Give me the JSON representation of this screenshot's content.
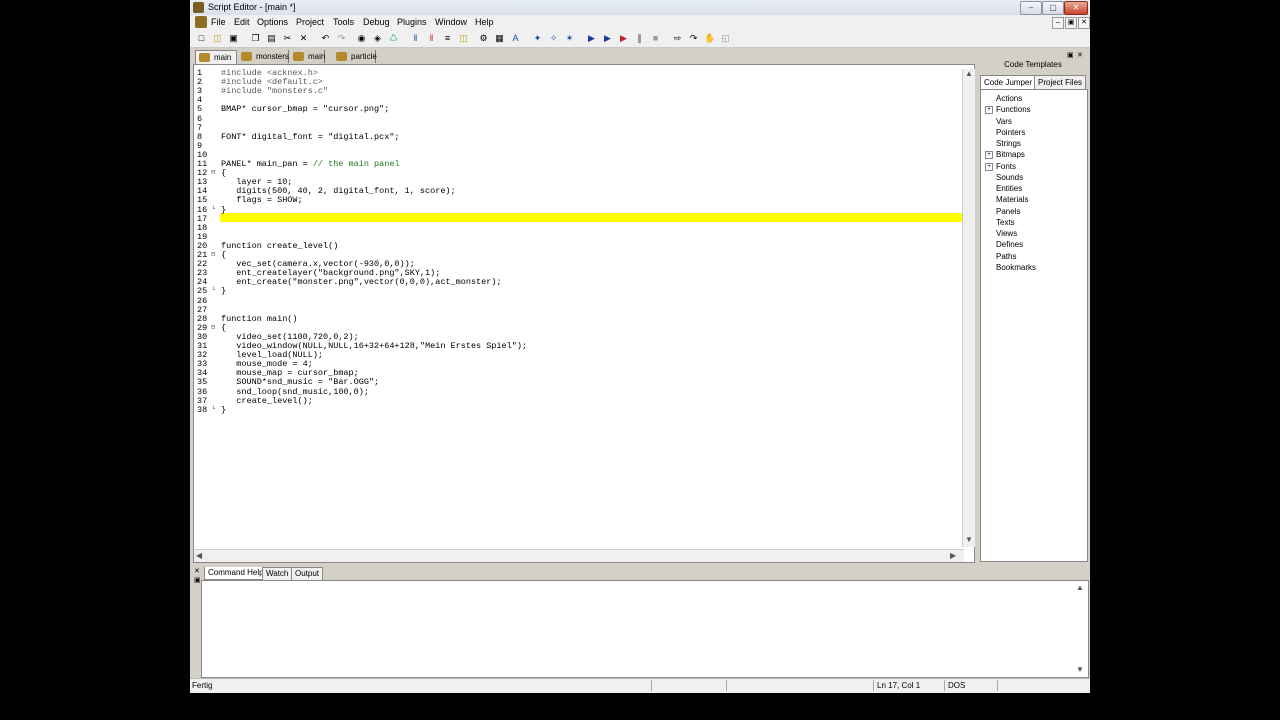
{
  "window": {
    "title": "Script Editor - [main *]"
  },
  "menu": [
    "File",
    "Edit",
    "Options",
    "Project",
    "Tools",
    "Debug",
    "Plugins",
    "Window",
    "Help"
  ],
  "tabs": [
    {
      "label": "main *",
      "active": true
    },
    {
      "label": "monsters",
      "active": false
    },
    {
      "label": "main",
      "active": false
    },
    {
      "label": "particle",
      "active": false
    }
  ],
  "code_lines": [
    "#include <acknex.h>",
    "#include <default.c>",
    "#include \"monsters.c\"",
    "",
    "BMAP* cursor_bmap = \"cursor.png\";",
    "",
    "",
    "FONT* digital_font = \"digital.pcx\";",
    "",
    "",
    "PANEL* main_pan = // the main panel",
    "{",
    "   layer = 10;",
    "   digits(500, 40, 2, digital_font, 1, score);",
    "   flags = SHOW;",
    "}",
    "",
    "",
    "",
    "function create_level()",
    "{",
    "   vec_set(camera.x,vector(-930,0,0));",
    "   ent_createlayer(\"background.png\",SKY,1);",
    "   ent_create(\"monster.png\",vector(0,0,0),act_monster);",
    "}",
    "",
    "",
    "function main()",
    "{",
    "   video_set(1100,720,0,2);",
    "   video_window(NULL,NULL,16+32+64+128,\"Mein Erstes Spiel\");",
    "   level_load(NULL);",
    "   mouse_mode = 4;",
    "   mouse_map = cursor_bmap;",
    "   SOUND*snd_music = \"Bar.OGG\";",
    "   snd_loop(snd_music,100,0);",
    "   create_level();",
    "}"
  ],
  "highlight_line": 17,
  "right_panel": {
    "header": "Code Templates",
    "tabs": [
      {
        "label": "Code Jumper",
        "active": true
      },
      {
        "label": "Project Files",
        "active": false
      }
    ],
    "tree": [
      {
        "label": "Actions",
        "expandable": false
      },
      {
        "label": "Functions",
        "expandable": true
      },
      {
        "label": "Vars",
        "expandable": false
      },
      {
        "label": "Pointers",
        "expandable": false
      },
      {
        "label": "Strings",
        "expandable": false
      },
      {
        "label": "Bitmaps",
        "expandable": true
      },
      {
        "label": "Fonts",
        "expandable": true
      },
      {
        "label": "Sounds",
        "expandable": false
      },
      {
        "label": "Entities",
        "expandable": false
      },
      {
        "label": "Materials",
        "expandable": false
      },
      {
        "label": "Panels",
        "expandable": false
      },
      {
        "label": "Texts",
        "expandable": false
      },
      {
        "label": "Views",
        "expandable": false
      },
      {
        "label": "Defines",
        "expandable": false
      },
      {
        "label": "Paths",
        "expandable": false
      },
      {
        "label": "Bookmarks",
        "expandable": false
      }
    ]
  },
  "bottom_tabs": [
    {
      "label": "Command Help",
      "active": true
    },
    {
      "label": "Watch",
      "active": false
    },
    {
      "label": "Output",
      "active": false
    }
  ],
  "status": {
    "left": "Fertig",
    "position": "Ln 17, Col 1",
    "mode": "DOS"
  }
}
